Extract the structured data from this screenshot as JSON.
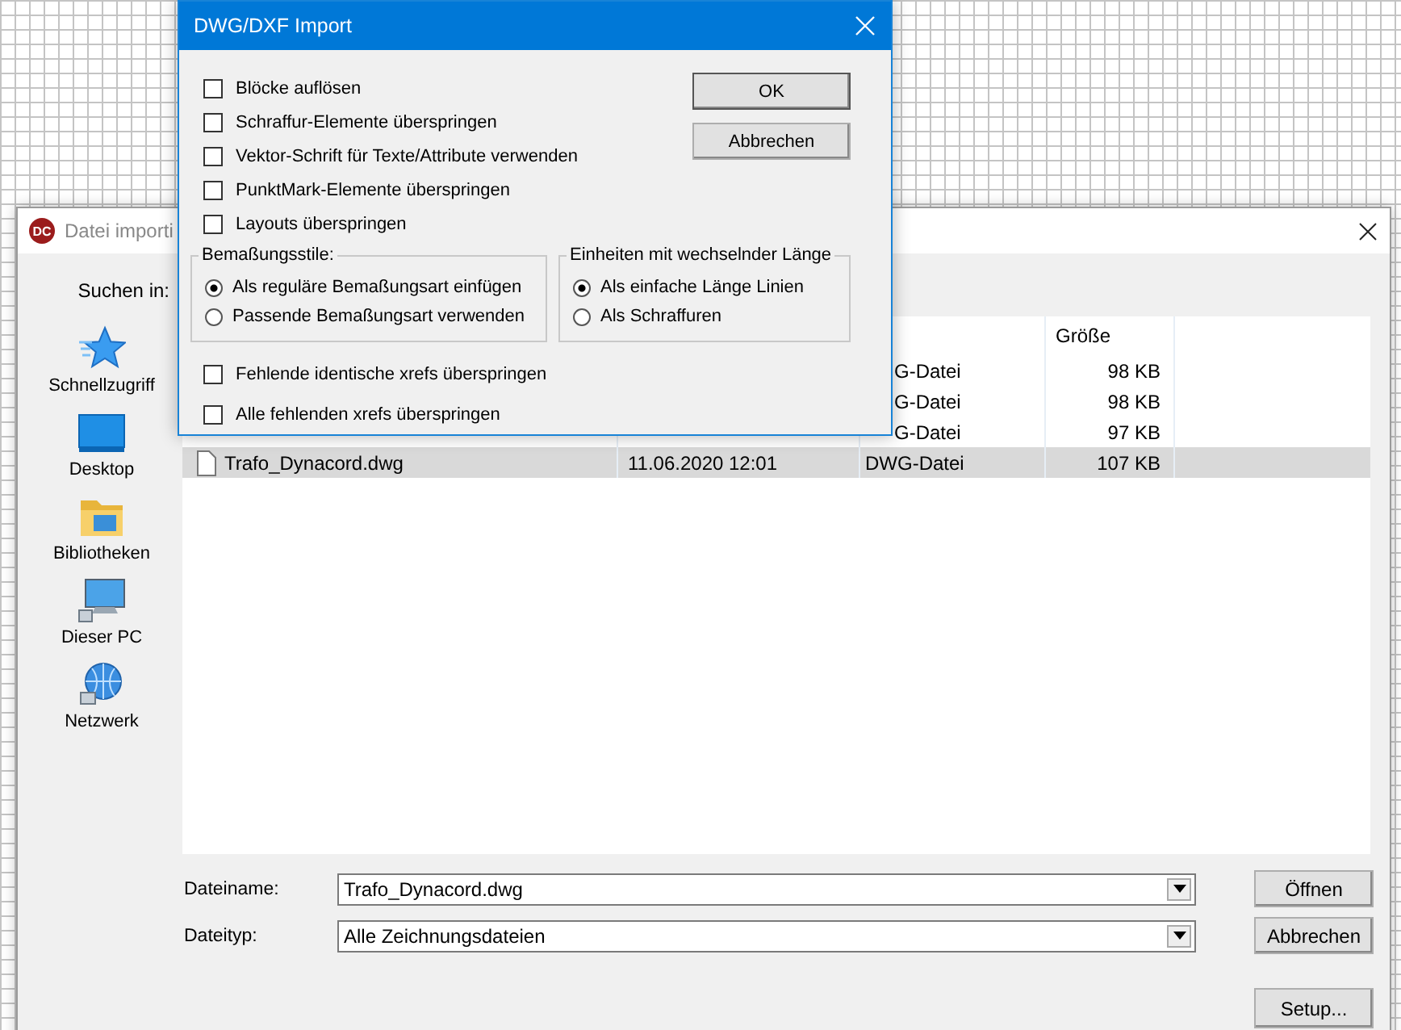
{
  "back_window": {
    "app_icon_text": "DC",
    "title": "Datei importi",
    "look_in_label": "Suchen in:",
    "places": [
      {
        "label": "Schnellzugriff",
        "kind": "star"
      },
      {
        "label": "Desktop",
        "kind": "desktop"
      },
      {
        "label": "Bibliotheken",
        "kind": "folder"
      },
      {
        "label": "Dieser PC",
        "kind": "pc"
      },
      {
        "label": "Netzwerk",
        "kind": "network"
      }
    ],
    "file_list": {
      "columns": [
        "Größe"
      ],
      "rows": [
        {
          "type": "G-Datei",
          "size": "98 KB",
          "covered": true,
          "selected": false
        },
        {
          "type": "G-Datei",
          "size": "98 KB",
          "covered": true,
          "selected": false
        },
        {
          "type": "G-Datei",
          "size": "97 KB",
          "covered": true,
          "selected": false
        },
        {
          "name": "Trafo_Dynacord.dwg",
          "date": "11.06.2020 12:01",
          "type": "DWG-Datei",
          "size": "107 KB",
          "covered": false,
          "selected": true
        }
      ]
    },
    "filename_label": "Dateiname:",
    "filename_value": "Trafo_Dynacord.dwg",
    "filetype_label": "Dateityp:",
    "filetype_value": "Alle Zeichnungsdateien",
    "buttons": [
      "Öffnen",
      "Abbrechen",
      "Setup..."
    ]
  },
  "import_dialog": {
    "title": "DWG/DXF Import",
    "options": [
      {
        "label": "Blöcke auflösen",
        "checked": false
      },
      {
        "label": "Schraffur-Elemente überspringen",
        "checked": false
      },
      {
        "label": "Vektor-Schrift für Texte/Attribute verwenden",
        "checked": false
      },
      {
        "label": "PunktMark-Elemente überspringen",
        "checked": false
      },
      {
        "label": "Layouts überspringen",
        "checked": false
      }
    ],
    "buttons": [
      "OK",
      "Abbrechen"
    ],
    "groups": [
      {
        "title": "Bemaßungsstile:",
        "options": [
          {
            "label": "Als reguläre Bemaßungsart einfügen",
            "selected": true
          },
          {
            "label": "Passende Bemaßungsart verwenden",
            "selected": false
          }
        ]
      },
      {
        "title": "Einheiten mit wechselnder Länge",
        "options": [
          {
            "label": "Als einfache Länge Linien",
            "selected": true
          },
          {
            "label": "Als Schraffuren",
            "selected": false
          }
        ]
      }
    ],
    "xref_options": [
      {
        "label": "Fehlende identische xrefs überspringen",
        "checked": false
      },
      {
        "label": "Alle fehlenden xrefs überspringen",
        "checked": false
      }
    ]
  }
}
